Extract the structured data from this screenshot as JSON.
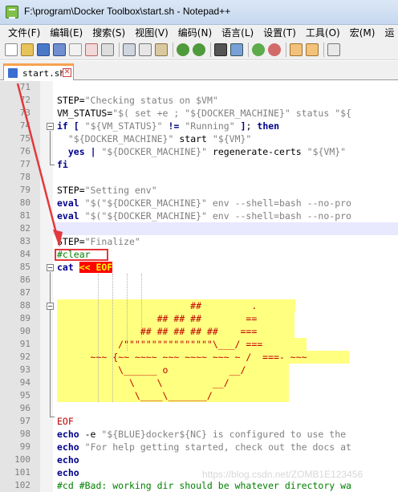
{
  "window": {
    "title": "F:\\program\\Docker Toolbox\\start.sh - Notepad++"
  },
  "menu": [
    "文件(F)",
    "编辑(E)",
    "搜索(S)",
    "视图(V)",
    "编码(N)",
    "语言(L)",
    "设置(T)",
    "工具(O)",
    "宏(M)",
    "运"
  ],
  "tab": {
    "label": "start.sh"
  },
  "lines": [
    {
      "n": "71",
      "text": ""
    },
    {
      "n": "72",
      "text": "STEP=\"Checking status on $VM\""
    },
    {
      "n": "73",
      "text": "VM_STATUS=\"$( set +e ; \"${DOCKER_MACHINE}\" status \"${"
    },
    {
      "n": "74",
      "text": "if [ \"${VM_STATUS}\" != \"Running\" ]; then"
    },
    {
      "n": "75",
      "text": "  \"${DOCKER_MACHINE}\" start \"${VM}\""
    },
    {
      "n": "76",
      "text": "  yes | \"${DOCKER_MACHINE}\" regenerate-certs \"${VM}\""
    },
    {
      "n": "77",
      "text": "fi"
    },
    {
      "n": "78",
      "text": ""
    },
    {
      "n": "79",
      "text": "STEP=\"Setting env\""
    },
    {
      "n": "80",
      "text": "eval \"$(\"${DOCKER_MACHINE}\" env --shell=bash --no-pro"
    },
    {
      "n": "81",
      "text": "eval \"$(\"${DOCKER_MACHINE}\" env --shell=bash --no-pro"
    },
    {
      "n": "82",
      "text": ""
    },
    {
      "n": "83",
      "text": "STEP=\"Finalize\""
    },
    {
      "n": "84",
      "text": "#clear"
    },
    {
      "n": "85",
      "text": "cat << EOF"
    },
    {
      "n": "86",
      "text": ""
    },
    {
      "n": "87",
      "text": ""
    },
    {
      "n": "88",
      "text": "                        ##         ."
    },
    {
      "n": "89",
      "text": "                  ## ## ##        =="
    },
    {
      "n": "90",
      "text": "               ## ## ## ## ##    ==="
    },
    {
      "n": "91",
      "text": "           /\"\"\"\"\"\"\"\"\"\"\"\"\"\"\"\"\\___/ ==="
    },
    {
      "n": "92",
      "text": "      ~~~ {~~ ~~~~ ~~~ ~~~~ ~~~ ~ /  ===- ~~~"
    },
    {
      "n": "93",
      "text": "           \\______ o           __/"
    },
    {
      "n": "94",
      "text": "             \\    \\         __/"
    },
    {
      "n": "95",
      "text": "              \\____\\_______/"
    },
    {
      "n": "96",
      "text": ""
    },
    {
      "n": "97",
      "text": "EOF"
    },
    {
      "n": "98",
      "text": "echo -e \"${BLUE}docker${NC} is configured to use the"
    },
    {
      "n": "99",
      "text": "echo \"For help getting started, check out the docs at"
    },
    {
      "n": "100",
      "text": "echo"
    },
    {
      "n": "101",
      "text": "echo"
    },
    {
      "n": "102",
      "text": "#cd #Bad: working dir should be whatever directory wa"
    }
  ],
  "watermark": "https://blog.csdn.net/ZOMB1E123456",
  "colors": {
    "keyword": "#00008b",
    "string": "#808080",
    "comment": "#008000",
    "heredoc_bg": "#ffff80",
    "annotation": "#e3383c"
  },
  "toolbar_icons": [
    "new-file-icon",
    "open-file-icon",
    "save-icon",
    "save-all-icon",
    "close-icon",
    "close-all-icon",
    "print-icon",
    "cut-icon",
    "copy-icon",
    "paste-icon",
    "undo-icon",
    "redo-icon",
    "find-icon",
    "replace-icon",
    "zoom-in-icon",
    "zoom-out-icon",
    "sync-v-icon",
    "sync-h-icon",
    "wrap-icon"
  ]
}
